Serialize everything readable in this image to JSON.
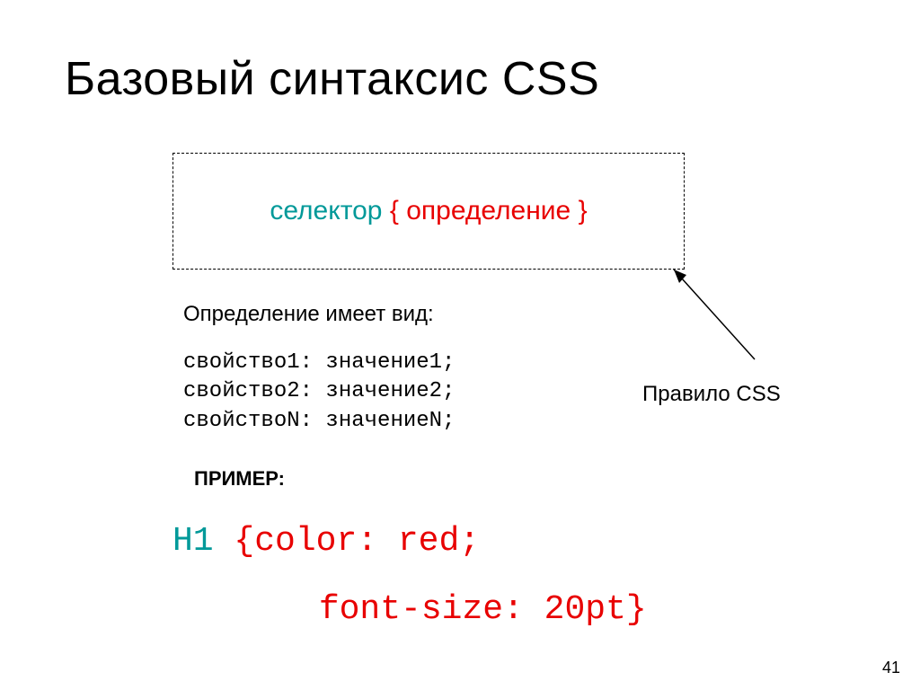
{
  "title": "Базовый синтаксис CSS",
  "rule_box": {
    "selector_word": "селектор",
    "open_brace": "{",
    "definition_word": "определение",
    "close_brace": "}"
  },
  "definition_label": "Определение имеет вид:",
  "properties": {
    "line1": "свойство1: значение1;",
    "line2": "свойство2: значение2;",
    "line3": "свойствоN: значениеN;"
  },
  "example_label": "ПРИМЕР:",
  "example": {
    "selector": "H1",
    "line1": "{color: red;",
    "line2": "font-size: 20pt}"
  },
  "rule_css_label": "Правило CSS",
  "page_number": "41"
}
